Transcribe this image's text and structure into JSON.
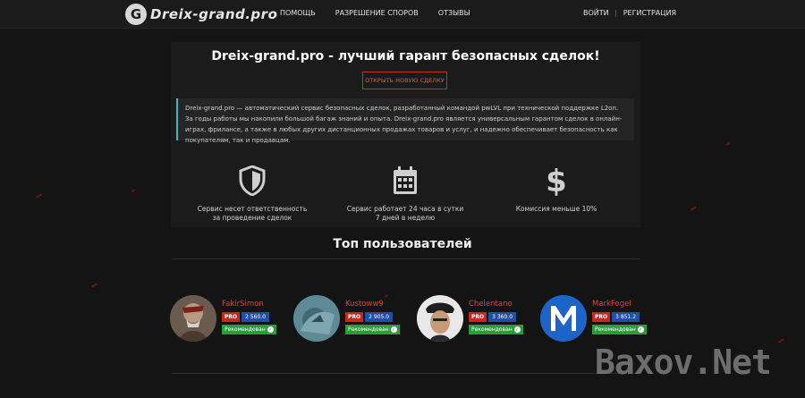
{
  "header": {
    "logo_mark": "G",
    "logo_text": "Dreix-grand.pro",
    "nav": [
      {
        "label": "ПОМОЩЬ"
      },
      {
        "label": "РАЗРЕШЕНИЕ СПОРОВ"
      },
      {
        "label": "ОТЗЫВЫ"
      }
    ],
    "login_label": "ВОЙТИ",
    "separator": "|",
    "register_label": "РЕГИСТРАЦИЯ"
  },
  "hero": {
    "title": "Dreix-grand.pro - лучший гарант безопасных сделок!",
    "cta_label": "ОТКРЫТЬ НОВУЮ СДЕЛКУ",
    "intro": "Dreix-grand.pro — автоматический сервис безопасных сделок, разработанный командой pwLVL при технической поддержке L2on. За годы работы мы накопили большой багаж знаний и опыта. Dreix-grand.pro является универсальным гарантом сделок в онлайн-играх, фрилансе, а также в любых других дистанционных продажах товаров и услуг, и надежно обеспечивает безопасность как покупателям, так и продавцам."
  },
  "features": [
    {
      "icon": "shield-icon",
      "text": "Сервис несет ответственность\nза проведение сделок"
    },
    {
      "icon": "calendar-icon",
      "text": "Сервис работает 24 часа в сутки\n7 дней в неделю"
    },
    {
      "icon": "dollar-icon",
      "text": "Комиссия меньше 10%"
    }
  ],
  "top_users": {
    "title": "Топ пользователей",
    "users": [
      {
        "name": "FakirSimon",
        "pro": "PRO",
        "score": "2 560.0",
        "status": "Рекомендован"
      },
      {
        "name": "Kustoww9",
        "pro": "PRO",
        "score": "2 905.0",
        "status": "Рекомендован"
      },
      {
        "name": "Chelentano",
        "pro": "PRO",
        "score": "3 360.0",
        "status": "Рекомендован"
      },
      {
        "name": "MarkFogel",
        "pro": "PRO",
        "score": "3 851.2",
        "status": "Рекомендован"
      }
    ]
  },
  "watermark": "Baxov.Net",
  "colors": {
    "accent_red": "#c9311f",
    "intro_border": "#3fb4c6",
    "pro_badge": "#c9261c",
    "score_badge": "#1f4fa8",
    "recommended_badge": "#2c9c3b"
  }
}
